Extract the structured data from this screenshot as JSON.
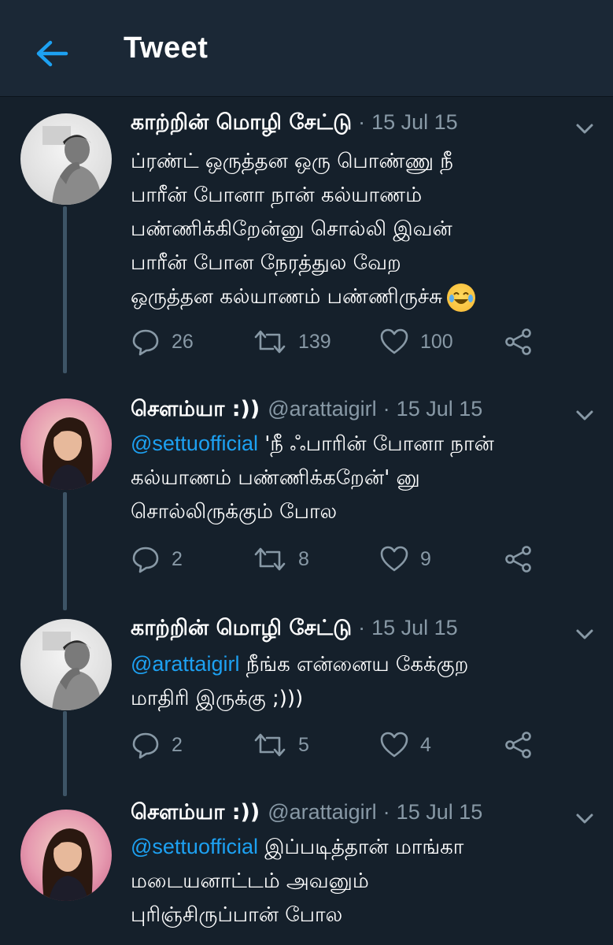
{
  "header": {
    "title": "Tweet"
  },
  "tweets": [
    {
      "name": "காற்றின் மொழி சேட்டு",
      "handle": "",
      "separator": "·",
      "date": "15 Jul 15",
      "mention": "",
      "lines": [
        "ப்ரண்ட் ஒருத்தன ஒரு பொண்ணு நீ",
        "பாரீன் போனா நான் கல்யாணம்",
        "பண்ணிக்கிறேன்னு சொல்லி இவன்",
        "பாரீன் போன நேரத்துல வேற",
        "ஒருத்தன கல்யாணம் பண்ணிருச்சு"
      ],
      "replies": "26",
      "retweets": "139",
      "likes": "100",
      "emoji": "face-with-tears-of-joy"
    },
    {
      "name": "சௌம்யா :))",
      "handle": "@arattaigirl",
      "separator": "·",
      "date": "15 Jul 15",
      "mention": "@settuofficial",
      "lines": [
        "'நீ ஃபாரின் போனா நான்",
        "கல்யாணம் பண்ணிக்கறேன்' னு",
        "சொல்லிருக்கும் போல"
      ],
      "replies": "2",
      "retweets": "8",
      "likes": "9"
    },
    {
      "name": "காற்றின் மொழி சேட்டு",
      "handle": "",
      "separator": "·",
      "date": "15 Jul 15",
      "mention": "@arattaigirl",
      "lines": [
        "நீங்க என்னைய கேக்குற",
        "மாதிரி இருக்கு ;)))"
      ],
      "replies": "2",
      "retweets": "5",
      "likes": "4"
    },
    {
      "name": "சௌம்யா :))",
      "handle": "@arattaigirl",
      "separator": "·",
      "date": "15 Jul 15",
      "mention": "@settuofficial",
      "lines": [
        "இப்படித்தான் மாங்கா",
        "மடையனாட்டம் அவனும்",
        "புரிஞ்சிருப்பான் போல"
      ]
    }
  ],
  "colors": {
    "background": "#15202b",
    "header": "#1b2836",
    "accent": "#1da1f2",
    "secondary_text": "#8899a6",
    "thread_line": "#3d5466"
  },
  "icons": [
    "back-arrow-icon",
    "chevron-down-icon",
    "reply-icon",
    "retweet-icon",
    "like-icon",
    "share-icon"
  ]
}
